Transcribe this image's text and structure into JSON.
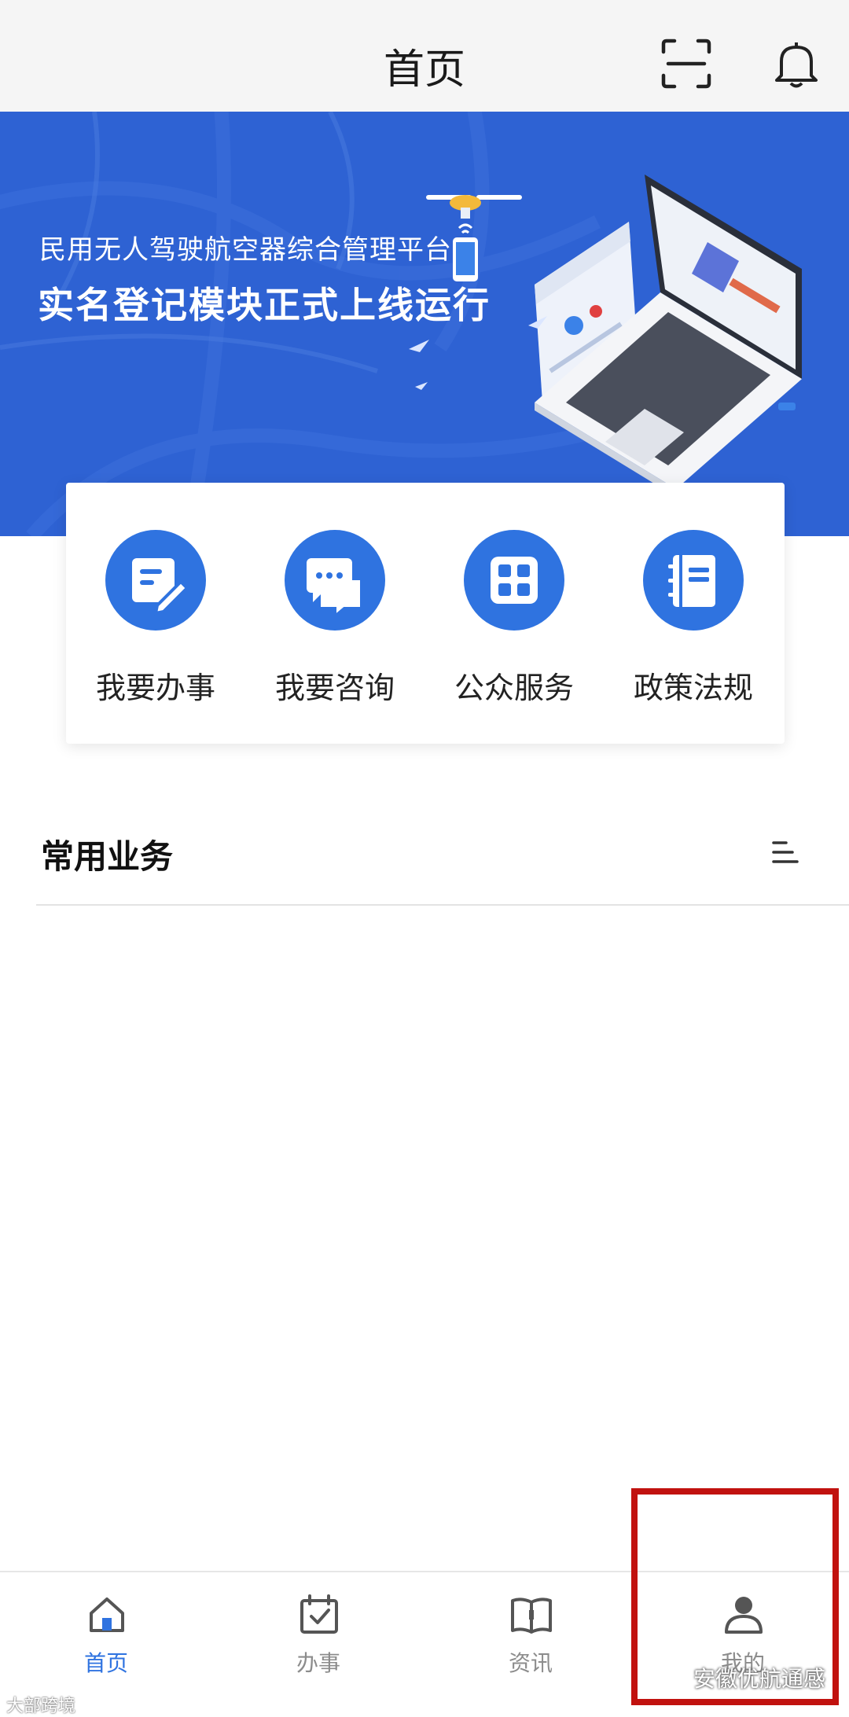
{
  "header": {
    "title": "首页"
  },
  "banner": {
    "subtitle": "民用无人驾驶航空器综合管理平台",
    "headline": "实名登记模块正式上线运行"
  },
  "quick_services": [
    {
      "label": "我要办事",
      "icon": "form-edit-icon"
    },
    {
      "label": "我要咨询",
      "icon": "chat-bubble-icon"
    },
    {
      "label": "公众服务",
      "icon": "grid-apps-icon"
    },
    {
      "label": "政策法规",
      "icon": "notebook-icon"
    }
  ],
  "common_business": {
    "title": "常用业务"
  },
  "tabbar": {
    "tabs": [
      {
        "label": "首页",
        "active": true
      },
      {
        "label": "办事",
        "active": false
      },
      {
        "label": "资讯",
        "active": false
      },
      {
        "label": "我的",
        "active": false
      }
    ]
  },
  "watermarks": {
    "left": "大部跨境",
    "right": "安徽优航通感"
  },
  "colors": {
    "primary": "#2f73e0",
    "banner": "#2e62d3",
    "highlight": "#c1120f"
  }
}
